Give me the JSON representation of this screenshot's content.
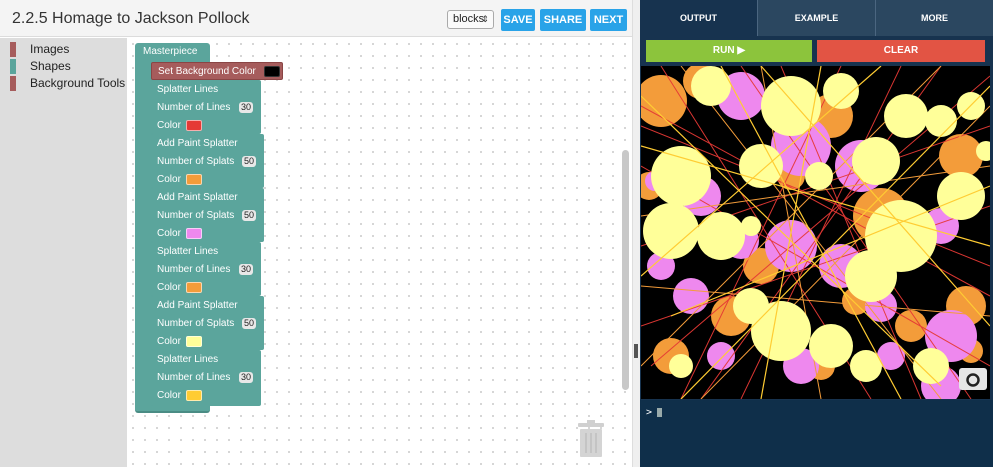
{
  "editor": {
    "title": "2.2.5 Homage to Jackson Pollock",
    "mode": "blocks",
    "buttons": {
      "save": "SAVE",
      "share": "SHARE",
      "next": "NEXT"
    }
  },
  "toolbox": {
    "categories": [
      {
        "label": "Images",
        "color": "#a65c5c"
      },
      {
        "label": "Shapes",
        "color": "#5ba59c"
      },
      {
        "label": "Background Tools",
        "color": "#a65c5c"
      }
    ]
  },
  "blocks": {
    "masterpiece": "Masterpiece",
    "set_background": {
      "label": "Set Background Color",
      "color": "#000000"
    },
    "items": [
      {
        "title": "Splatter Lines",
        "param": "Number of Lines",
        "value": "30",
        "color_label": "Color",
        "color": "#e53935"
      },
      {
        "title": "Add Paint Splatter",
        "param": "Number of Splats",
        "value": "50",
        "color_label": "Color",
        "color": "#f39c3a"
      },
      {
        "title": "Add Paint Splatter",
        "param": "Number of Splats",
        "value": "50",
        "color_label": "Color",
        "color": "#ee88ee"
      },
      {
        "title": "Splatter Lines",
        "param": "Number of Lines",
        "value": "30",
        "color_label": "Color",
        "color": "#f39c3a"
      },
      {
        "title": "Add Paint Splatter",
        "param": "Number of Splats",
        "value": "50",
        "color_label": "Color",
        "color": "#ffff99"
      },
      {
        "title": "Splatter Lines",
        "param": "Number of Lines",
        "value": "30",
        "color_label": "Color",
        "color": "#ffcc33"
      }
    ]
  },
  "output": {
    "tabs": [
      "OUTPUT",
      "EXAMPLE",
      "MORE"
    ],
    "run_label": "RUN ▶",
    "clear_label": "CLEAR",
    "console_prompt": ">"
  },
  "colors": {
    "accent_blue": "#29a3e8",
    "run_green": "#8cc43c",
    "clear_red": "#e25444",
    "canvas_bg": "#000000",
    "splat_yellow": "#ffff99",
    "splat_pink": "#ee88ee",
    "splat_orange": "#f39c3a",
    "line_red": "#e53935",
    "line_orange": "#f39c3a",
    "line_gold": "#ffcc33"
  }
}
